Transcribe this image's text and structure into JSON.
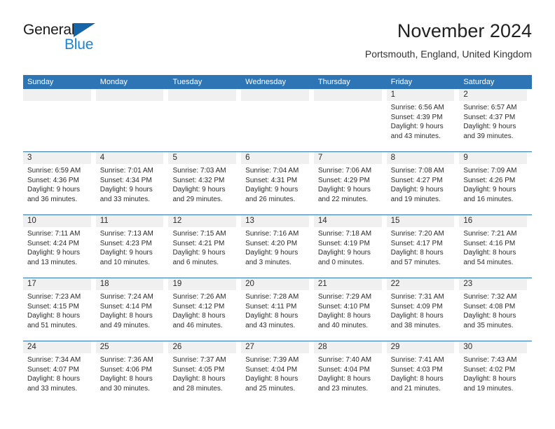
{
  "brand": {
    "line1": "General",
    "line2": "Blue",
    "triangle_color": "#1565a8",
    "blue_color": "#1a84d6"
  },
  "header": {
    "title": "November 2024",
    "subtitle": "Portsmouth, England, United Kingdom"
  },
  "colors": {
    "header_blue": "#2e75b6",
    "day_band_gray": "#f0f0f0",
    "text": "#2b2b2b"
  },
  "weekdays": [
    "Sunday",
    "Monday",
    "Tuesday",
    "Wednesday",
    "Thursday",
    "Friday",
    "Saturday"
  ],
  "weeks": [
    [
      {
        "day": "",
        "sunrise": "",
        "sunset": "",
        "daylight1": "",
        "daylight2": ""
      },
      {
        "day": "",
        "sunrise": "",
        "sunset": "",
        "daylight1": "",
        "daylight2": ""
      },
      {
        "day": "",
        "sunrise": "",
        "sunset": "",
        "daylight1": "",
        "daylight2": ""
      },
      {
        "day": "",
        "sunrise": "",
        "sunset": "",
        "daylight1": "",
        "daylight2": ""
      },
      {
        "day": "",
        "sunrise": "",
        "sunset": "",
        "daylight1": "",
        "daylight2": ""
      },
      {
        "day": "1",
        "sunrise": "Sunrise: 6:56 AM",
        "sunset": "Sunset: 4:39 PM",
        "daylight1": "Daylight: 9 hours",
        "daylight2": "and 43 minutes."
      },
      {
        "day": "2",
        "sunrise": "Sunrise: 6:57 AM",
        "sunset": "Sunset: 4:37 PM",
        "daylight1": "Daylight: 9 hours",
        "daylight2": "and 39 minutes."
      }
    ],
    [
      {
        "day": "3",
        "sunrise": "Sunrise: 6:59 AM",
        "sunset": "Sunset: 4:36 PM",
        "daylight1": "Daylight: 9 hours",
        "daylight2": "and 36 minutes."
      },
      {
        "day": "4",
        "sunrise": "Sunrise: 7:01 AM",
        "sunset": "Sunset: 4:34 PM",
        "daylight1": "Daylight: 9 hours",
        "daylight2": "and 33 minutes."
      },
      {
        "day": "5",
        "sunrise": "Sunrise: 7:03 AM",
        "sunset": "Sunset: 4:32 PM",
        "daylight1": "Daylight: 9 hours",
        "daylight2": "and 29 minutes."
      },
      {
        "day": "6",
        "sunrise": "Sunrise: 7:04 AM",
        "sunset": "Sunset: 4:31 PM",
        "daylight1": "Daylight: 9 hours",
        "daylight2": "and 26 minutes."
      },
      {
        "day": "7",
        "sunrise": "Sunrise: 7:06 AM",
        "sunset": "Sunset: 4:29 PM",
        "daylight1": "Daylight: 9 hours",
        "daylight2": "and 22 minutes."
      },
      {
        "day": "8",
        "sunrise": "Sunrise: 7:08 AM",
        "sunset": "Sunset: 4:27 PM",
        "daylight1": "Daylight: 9 hours",
        "daylight2": "and 19 minutes."
      },
      {
        "day": "9",
        "sunrise": "Sunrise: 7:09 AM",
        "sunset": "Sunset: 4:26 PM",
        "daylight1": "Daylight: 9 hours",
        "daylight2": "and 16 minutes."
      }
    ],
    [
      {
        "day": "10",
        "sunrise": "Sunrise: 7:11 AM",
        "sunset": "Sunset: 4:24 PM",
        "daylight1": "Daylight: 9 hours",
        "daylight2": "and 13 minutes."
      },
      {
        "day": "11",
        "sunrise": "Sunrise: 7:13 AM",
        "sunset": "Sunset: 4:23 PM",
        "daylight1": "Daylight: 9 hours",
        "daylight2": "and 10 minutes."
      },
      {
        "day": "12",
        "sunrise": "Sunrise: 7:15 AM",
        "sunset": "Sunset: 4:21 PM",
        "daylight1": "Daylight: 9 hours",
        "daylight2": "and 6 minutes."
      },
      {
        "day": "13",
        "sunrise": "Sunrise: 7:16 AM",
        "sunset": "Sunset: 4:20 PM",
        "daylight1": "Daylight: 9 hours",
        "daylight2": "and 3 minutes."
      },
      {
        "day": "14",
        "sunrise": "Sunrise: 7:18 AM",
        "sunset": "Sunset: 4:19 PM",
        "daylight1": "Daylight: 9 hours",
        "daylight2": "and 0 minutes."
      },
      {
        "day": "15",
        "sunrise": "Sunrise: 7:20 AM",
        "sunset": "Sunset: 4:17 PM",
        "daylight1": "Daylight: 8 hours",
        "daylight2": "and 57 minutes."
      },
      {
        "day": "16",
        "sunrise": "Sunrise: 7:21 AM",
        "sunset": "Sunset: 4:16 PM",
        "daylight1": "Daylight: 8 hours",
        "daylight2": "and 54 minutes."
      }
    ],
    [
      {
        "day": "17",
        "sunrise": "Sunrise: 7:23 AM",
        "sunset": "Sunset: 4:15 PM",
        "daylight1": "Daylight: 8 hours",
        "daylight2": "and 51 minutes."
      },
      {
        "day": "18",
        "sunrise": "Sunrise: 7:24 AM",
        "sunset": "Sunset: 4:14 PM",
        "daylight1": "Daylight: 8 hours",
        "daylight2": "and 49 minutes."
      },
      {
        "day": "19",
        "sunrise": "Sunrise: 7:26 AM",
        "sunset": "Sunset: 4:12 PM",
        "daylight1": "Daylight: 8 hours",
        "daylight2": "and 46 minutes."
      },
      {
        "day": "20",
        "sunrise": "Sunrise: 7:28 AM",
        "sunset": "Sunset: 4:11 PM",
        "daylight1": "Daylight: 8 hours",
        "daylight2": "and 43 minutes."
      },
      {
        "day": "21",
        "sunrise": "Sunrise: 7:29 AM",
        "sunset": "Sunset: 4:10 PM",
        "daylight1": "Daylight: 8 hours",
        "daylight2": "and 40 minutes."
      },
      {
        "day": "22",
        "sunrise": "Sunrise: 7:31 AM",
        "sunset": "Sunset: 4:09 PM",
        "daylight1": "Daylight: 8 hours",
        "daylight2": "and 38 minutes."
      },
      {
        "day": "23",
        "sunrise": "Sunrise: 7:32 AM",
        "sunset": "Sunset: 4:08 PM",
        "daylight1": "Daylight: 8 hours",
        "daylight2": "and 35 minutes."
      }
    ],
    [
      {
        "day": "24",
        "sunrise": "Sunrise: 7:34 AM",
        "sunset": "Sunset: 4:07 PM",
        "daylight1": "Daylight: 8 hours",
        "daylight2": "and 33 minutes."
      },
      {
        "day": "25",
        "sunrise": "Sunrise: 7:36 AM",
        "sunset": "Sunset: 4:06 PM",
        "daylight1": "Daylight: 8 hours",
        "daylight2": "and 30 minutes."
      },
      {
        "day": "26",
        "sunrise": "Sunrise: 7:37 AM",
        "sunset": "Sunset: 4:05 PM",
        "daylight1": "Daylight: 8 hours",
        "daylight2": "and 28 minutes."
      },
      {
        "day": "27",
        "sunrise": "Sunrise: 7:39 AM",
        "sunset": "Sunset: 4:04 PM",
        "daylight1": "Daylight: 8 hours",
        "daylight2": "and 25 minutes."
      },
      {
        "day": "28",
        "sunrise": "Sunrise: 7:40 AM",
        "sunset": "Sunset: 4:04 PM",
        "daylight1": "Daylight: 8 hours",
        "daylight2": "and 23 minutes."
      },
      {
        "day": "29",
        "sunrise": "Sunrise: 7:41 AM",
        "sunset": "Sunset: 4:03 PM",
        "daylight1": "Daylight: 8 hours",
        "daylight2": "and 21 minutes."
      },
      {
        "day": "30",
        "sunrise": "Sunrise: 7:43 AM",
        "sunset": "Sunset: 4:02 PM",
        "daylight1": "Daylight: 8 hours",
        "daylight2": "and 19 minutes."
      }
    ]
  ]
}
